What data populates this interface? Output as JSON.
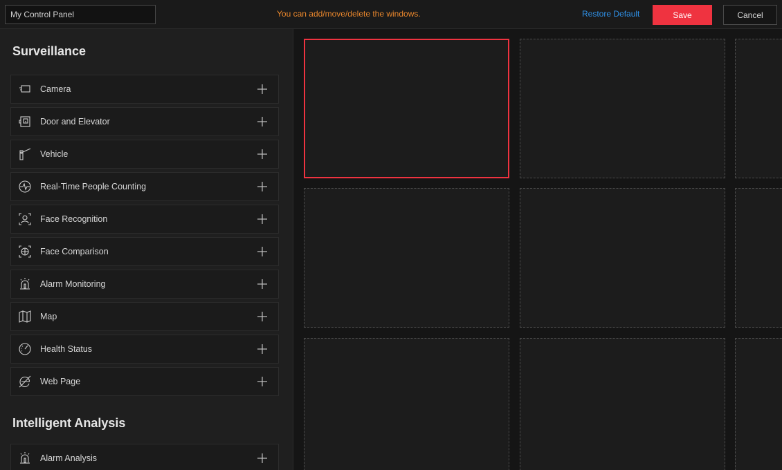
{
  "topbar": {
    "panel_name": "My Control Panel",
    "hint": "You can add/move/delete the windows.",
    "restore_label": "Restore Default",
    "save_label": "Save",
    "cancel_label": "Cancel"
  },
  "sidebar": {
    "sections": [
      {
        "title": "Surveillance",
        "items": [
          {
            "label": "Camera",
            "icon": "camera-icon"
          },
          {
            "label": "Door and Elevator",
            "icon": "door-elevator-icon"
          },
          {
            "label": "Vehicle",
            "icon": "vehicle-barrier-icon"
          },
          {
            "label": "Real-Time People Counting",
            "icon": "people-counting-icon"
          },
          {
            "label": "Face Recognition",
            "icon": "face-recognition-icon"
          },
          {
            "label": "Face Comparison",
            "icon": "face-comparison-icon"
          },
          {
            "label": "Alarm Monitoring",
            "icon": "alarm-icon"
          },
          {
            "label": "Map",
            "icon": "map-icon"
          },
          {
            "label": "Health Status",
            "icon": "gauge-icon"
          },
          {
            "label": "Web Page",
            "icon": "web-page-icon"
          }
        ]
      },
      {
        "title": "Intelligent Analysis",
        "items": [
          {
            "label": "Alarm Analysis",
            "icon": "alarm-icon"
          }
        ]
      }
    ]
  },
  "colors": {
    "accent": "#ef3340",
    "hint": "#e8862c",
    "link": "#2f90e6"
  }
}
